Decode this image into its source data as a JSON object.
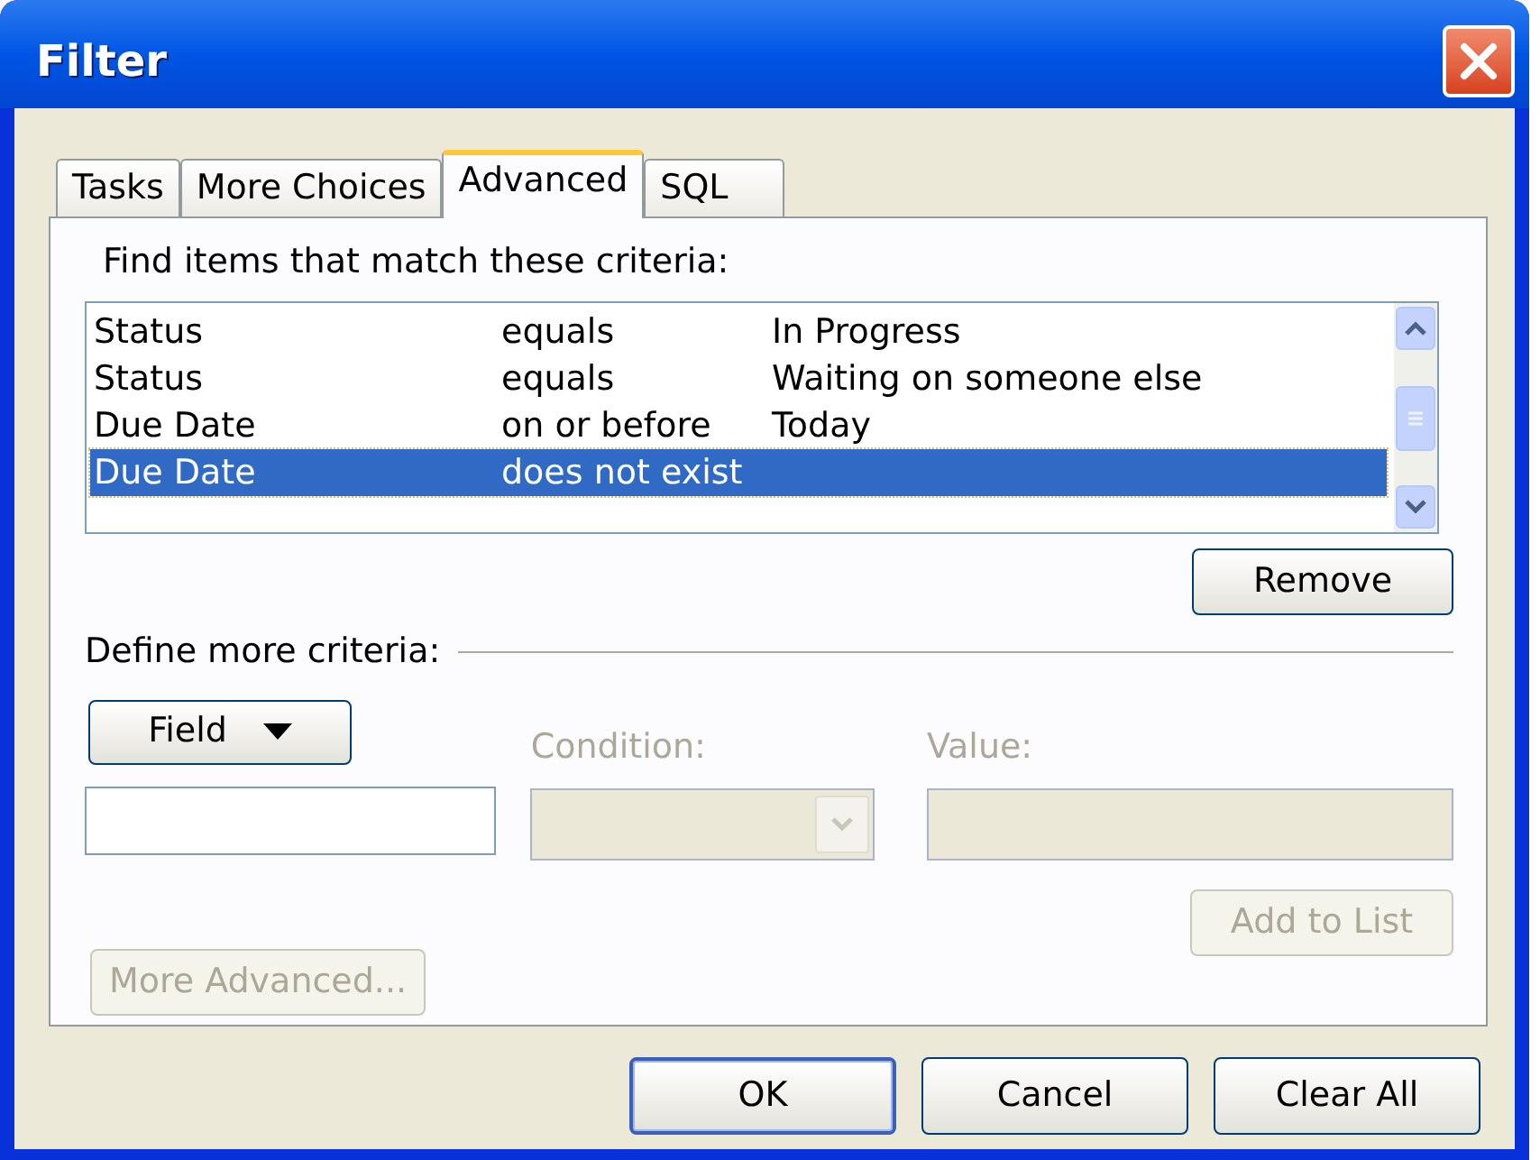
{
  "window": {
    "title": "Filter"
  },
  "tabs": [
    {
      "label": "Tasks",
      "selected": false
    },
    {
      "label": "More Choices",
      "selected": false
    },
    {
      "label": "Advanced",
      "selected": true
    },
    {
      "label": "SQL",
      "selected": false
    }
  ],
  "criteria_label": "Find items that match these criteria:",
  "criteria": [
    {
      "field": "Status",
      "condition": "equals",
      "value": "In Progress",
      "selected": false
    },
    {
      "field": "Status",
      "condition": "equals",
      "value": "Waiting on someone else",
      "selected": false
    },
    {
      "field": "Due Date",
      "condition": "on or before",
      "value": "Today",
      "selected": false
    },
    {
      "field": "Due Date",
      "condition": "does not exist",
      "selected": true
    }
  ],
  "remove_button": {
    "label": "Remove",
    "disabled": false
  },
  "define_label": "Define more criteria:",
  "field_button": {
    "label": "Field"
  },
  "condition": {
    "label": "Condition:",
    "disabled": true
  },
  "value": {
    "label": "Value:",
    "disabled": true
  },
  "add_button": {
    "label": "Add to List",
    "disabled": true
  },
  "more_advanced_button": {
    "label": "More Advanced...",
    "disabled": true
  },
  "buttons": [
    {
      "label": "OK",
      "default": true
    },
    {
      "label": "Cancel",
      "default": false
    },
    {
      "label": "Clear All",
      "default": false
    }
  ]
}
